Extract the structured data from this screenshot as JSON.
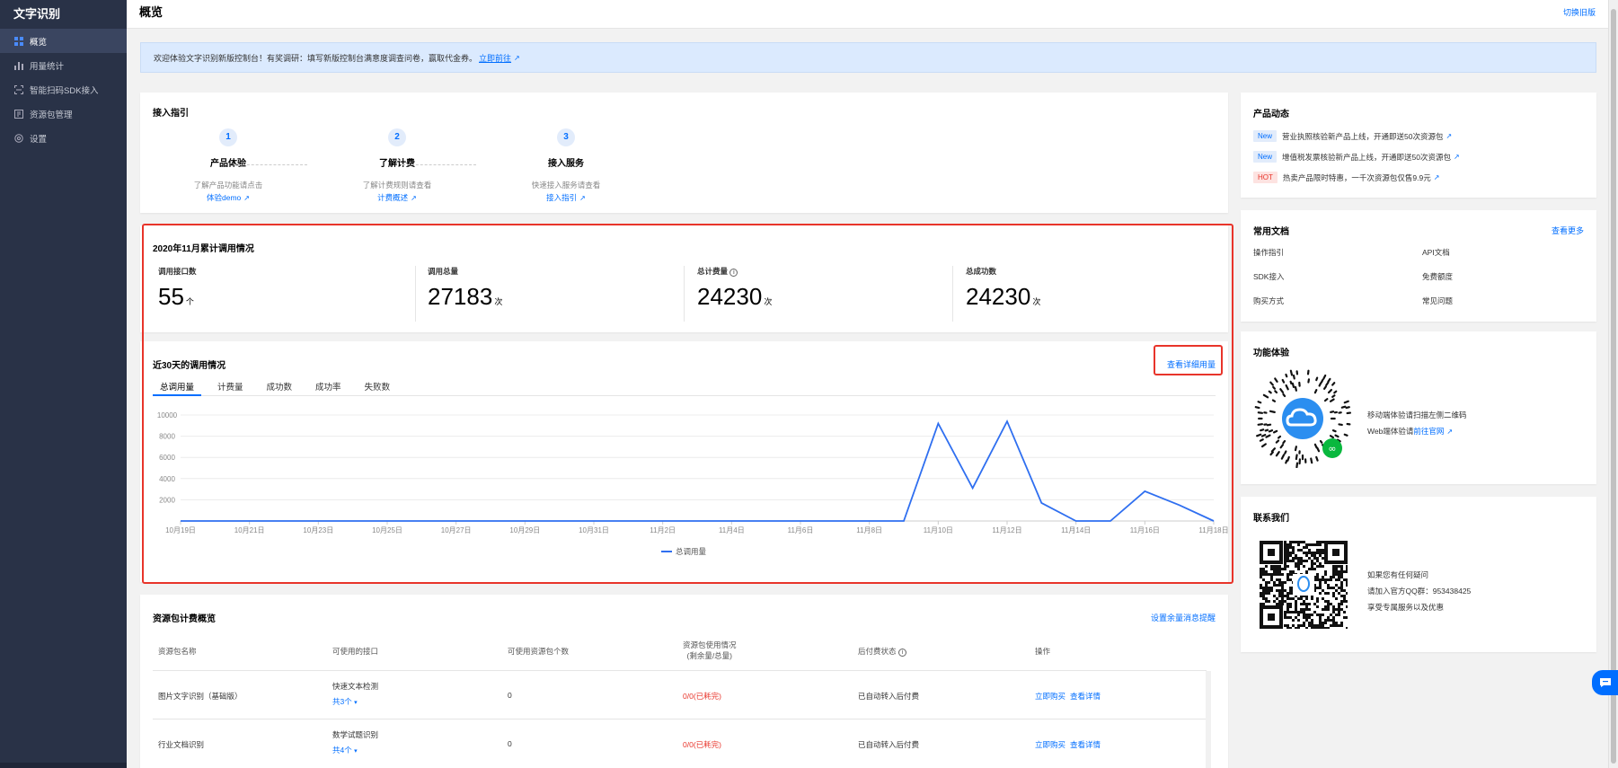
{
  "app": {
    "brand": "文字识别"
  },
  "sidebar": {
    "items": [
      {
        "label": "概览",
        "icon": "grid-icon",
        "active": true
      },
      {
        "label": "用量统计",
        "icon": "bar-chart-icon"
      },
      {
        "label": "智能扫码SDK接入",
        "icon": "scan-icon"
      },
      {
        "label": "资源包管理",
        "icon": "package-icon"
      },
      {
        "label": "设置",
        "icon": "gear-icon"
      }
    ]
  },
  "header": {
    "title": "概览",
    "switch_label": "切换旧版"
  },
  "banner": {
    "text": "欢迎体验文字识别新版控制台！有奖调研：填写新版控制台满意度调查问卷，赢取代金券。",
    "link": "立即前往"
  },
  "guide": {
    "title": "接入指引",
    "steps": [
      {
        "num": "1",
        "name": "产品体验",
        "desc": "了解产品功能请点击",
        "link": "体验demo"
      },
      {
        "num": "2",
        "name": "了解计费",
        "desc": "了解计费规则请查看",
        "link": "计费概述"
      },
      {
        "num": "3",
        "name": "接入服务",
        "desc": "快速接入服务请查看",
        "link": "接入指引"
      }
    ]
  },
  "stats": {
    "title": "2020年11月累计调用情况",
    "items": [
      {
        "label": "调用接口数",
        "value": "55",
        "unit": "个"
      },
      {
        "label": "调用总量",
        "value": "27183",
        "unit": "次"
      },
      {
        "label": "总计费量",
        "value": "24230",
        "unit": "次"
      },
      {
        "label": "总成功数",
        "value": "24230",
        "unit": "次"
      }
    ]
  },
  "usage": {
    "title": "近30天的调用情况",
    "detail_link": "查看详细用量",
    "tabs": [
      "总调用量",
      "计费量",
      "成功数",
      "成功率",
      "失败数"
    ]
  },
  "chart_data": {
    "type": "line",
    "x": [
      "10月19日",
      "10月20日",
      "10月21日",
      "10月22日",
      "10月23日",
      "10月24日",
      "10月25日",
      "10月26日",
      "10月27日",
      "10月28日",
      "10月29日",
      "10月30日",
      "10月31日",
      "11月1日",
      "11月2日",
      "11月3日",
      "11月4日",
      "11月5日",
      "11月6日",
      "11月7日",
      "11月8日",
      "11月9日",
      "11月10日",
      "11月11日",
      "11月12日",
      "11月13日",
      "11月14日",
      "11月15日",
      "11月16日",
      "11月17日",
      "11月18日"
    ],
    "xticks": [
      "10月19日",
      "10月21日",
      "10月23日",
      "10月25日",
      "10月27日",
      "10月29日",
      "10月31日",
      "11月2日",
      "11月4日",
      "11月6日",
      "11月8日",
      "11月10日",
      "11月12日",
      "11月14日",
      "11月16日",
      "11月18日"
    ],
    "series": [
      {
        "name": "总调用量",
        "color": "#2f6ff0",
        "values": [
          0,
          0,
          0,
          0,
          0,
          0,
          0,
          0,
          0,
          0,
          0,
          0,
          0,
          0,
          0,
          0,
          0,
          0,
          0,
          0,
          0,
          0,
          9200,
          3100,
          9400,
          1700,
          0,
          0,
          2800,
          1500,
          0
        ]
      }
    ],
    "yticks": [
      2000,
      4000,
      6000,
      8000,
      10000
    ],
    "ylim": [
      0,
      10000
    ],
    "grid": true,
    "legend": "bottom-center"
  },
  "resources": {
    "title": "资源包计费概览",
    "remind_link": "设置余量消息提醒",
    "headers": [
      "资源包名称",
      "可使用的接口",
      "可使用资源包个数",
      "资源包使用情况",
      "(剩余量/总量)",
      "后付费状态",
      "操作"
    ],
    "rows": [
      {
        "name": "图片文字识别（基础版）",
        "api": "快速文本检测",
        "api_more": "共3个",
        "count": "0",
        "usage": "0/0(已耗完)",
        "status": "已自动转入后付费",
        "buy": "立即购买",
        "detail": "查看详情"
      },
      {
        "name": "行业文档识别",
        "api": "数学试题识别",
        "api_more": "共4个",
        "count": "0",
        "usage": "0/0(已耗完)",
        "status": "已自动转入后付费",
        "buy": "立即购买",
        "detail": "查看详情"
      }
    ]
  },
  "news": {
    "title": "产品动态",
    "items": [
      {
        "tag": "New",
        "text": "营业执照核验新产品上线，开通即送50次资源包"
      },
      {
        "tag": "New",
        "text": "增值税发票核验新产品上线，开通即送50次资源包"
      },
      {
        "tag": "HOT",
        "text": "热卖产品限时特惠，一千次资源包仅售9.9元"
      }
    ]
  },
  "docs": {
    "title": "常用文档",
    "more": "查看更多",
    "links": [
      "操作指引",
      "API文档",
      "SDK接入",
      "免费额度",
      "购买方式",
      "常见问题"
    ]
  },
  "feature": {
    "title": "功能体验",
    "line1": "移动端体验请扫描左侧二维码",
    "line2_prefix": "Web端体验请",
    "line2_link": "前往官网"
  },
  "contact": {
    "title": "联系我们",
    "line1": "如果您有任何疑问",
    "line2": "请加入官方QQ群：953438425",
    "line3": "享受专属服务以及优惠"
  }
}
